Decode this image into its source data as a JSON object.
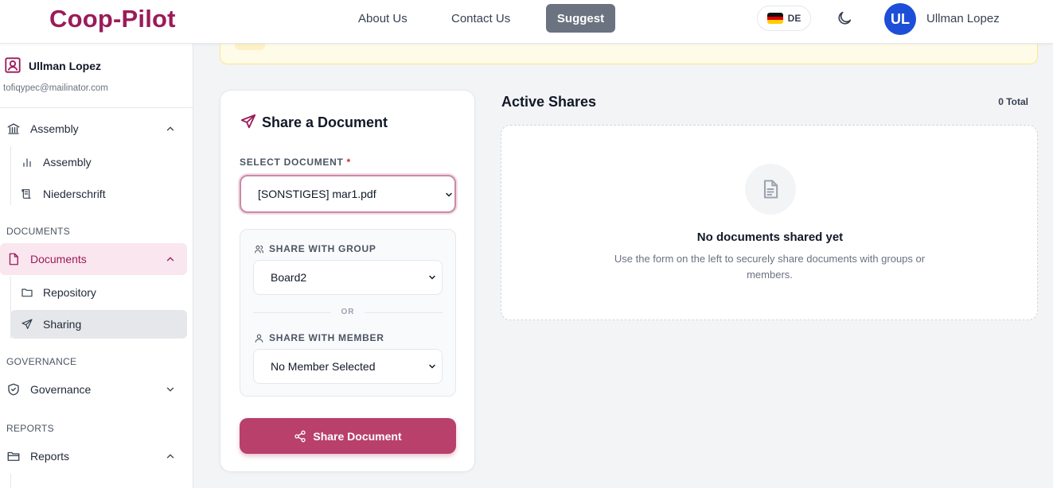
{
  "header": {
    "logo": "Coop-Pilot",
    "nav": {
      "about": "About Us",
      "contact": "Contact Us",
      "suggest": "Suggest"
    },
    "language": "DE",
    "theme_icon": "moon-icon",
    "user": {
      "initials": "UL",
      "name": "Ullman Lopez"
    }
  },
  "sidebar": {
    "user": {
      "name": "Ullman Lopez",
      "email": "tofiqypec@mailinator.com"
    },
    "assembly": {
      "label": "Assembly",
      "sub": [
        "Assembly",
        "Niederschrift"
      ]
    },
    "sections": {
      "documents": "DOCUMENTS",
      "governance": "GOVERNANCE",
      "reports": "REPORTS"
    },
    "documents": {
      "label": "Documents",
      "sub": [
        "Repository",
        "Sharing"
      ]
    },
    "governance": {
      "label": "Governance"
    },
    "reports": {
      "label": "Reports"
    }
  },
  "share_form": {
    "title": "Share a Document",
    "select_document_label": "SELECT DOCUMENT",
    "required_marker": "*",
    "selected_document": "[SONSTIGES] mar1.pdf",
    "share_group_label": "SHARE WITH GROUP",
    "selected_group": "Board2",
    "or_label": "OR",
    "share_member_label": "SHARE WITH MEMBER",
    "selected_member": "No Member Selected",
    "submit_label": "Share Document"
  },
  "active_shares": {
    "title": "Active Shares",
    "total": "0 Total",
    "empty_title": "No documents shared yet",
    "empty_desc": "Use the form on the left to securely share documents with groups or members."
  },
  "colors": {
    "brand": "#9b1b5a",
    "accent": "#b9406b",
    "avatar": "#1d4ed8"
  }
}
